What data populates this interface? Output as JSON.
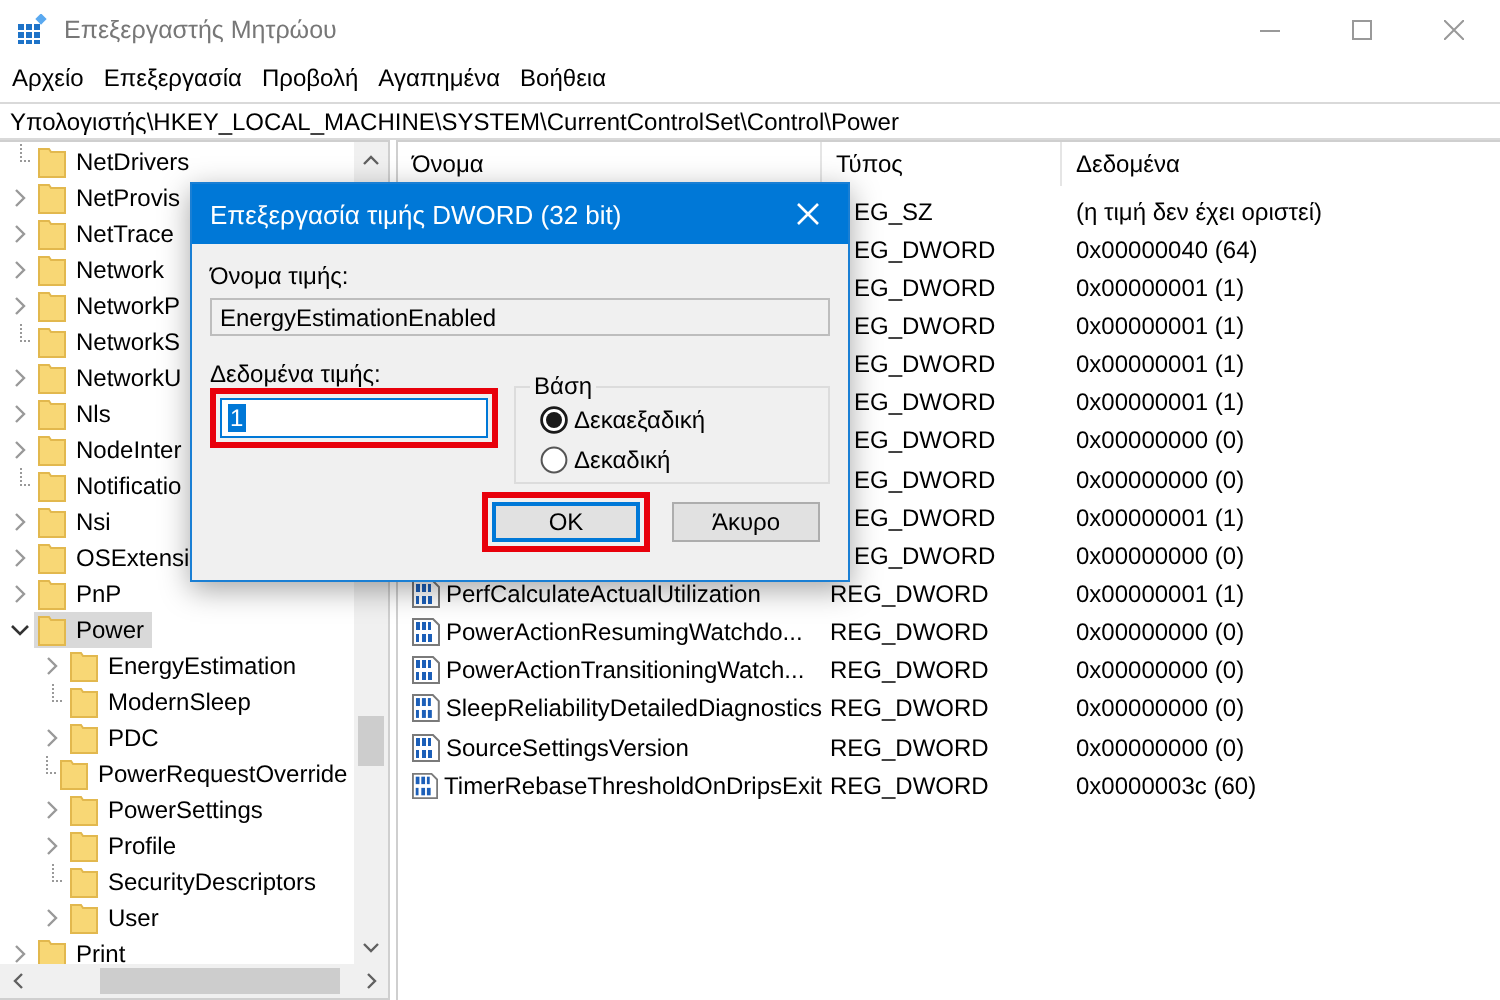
{
  "window": {
    "title": "Επεξεργαστής Μητρώου"
  },
  "menu": [
    "Αρχείο",
    "Επεξεργασία",
    "Προβολή",
    "Αγαπημένα",
    "Βοήθεια"
  ],
  "address": "Υπολογιστής\\HKEY_LOCAL_MACHINE\\SYSTEM\\CurrentControlSet\\Control\\Power",
  "tree": [
    {
      "label": "NetDrivers",
      "kind": "leaf",
      "selected": false
    },
    {
      "label": "NetProvis",
      "kind": "branch",
      "expanded": false,
      "selected": false
    },
    {
      "label": "NetTrace",
      "kind": "branch",
      "expanded": false,
      "selected": false
    },
    {
      "label": "Network",
      "kind": "branch",
      "expanded": false,
      "selected": false
    },
    {
      "label": "NetworkP",
      "kind": "branch",
      "expanded": false,
      "selected": false
    },
    {
      "label": "NetworkS",
      "kind": "leaf",
      "selected": false
    },
    {
      "label": "NetworkU",
      "kind": "branch",
      "expanded": false,
      "selected": false
    },
    {
      "label": "Nls",
      "kind": "branch",
      "expanded": false,
      "selected": false
    },
    {
      "label": "NodeInter",
      "kind": "branch",
      "expanded": false,
      "selected": false
    },
    {
      "label": "Notificatio",
      "kind": "leaf",
      "selected": false
    },
    {
      "label": "Nsi",
      "kind": "branch",
      "expanded": false,
      "selected": false
    },
    {
      "label": "OSExtensi",
      "kind": "branch",
      "expanded": false,
      "selected": false
    },
    {
      "label": "PnP",
      "kind": "branch",
      "expanded": false,
      "selected": false
    },
    {
      "label": "Power",
      "kind": "branch",
      "expanded": true,
      "selected": true,
      "children": [
        {
          "label": "EnergyEstimation",
          "kind": "branch",
          "expanded": false,
          "selected": false
        },
        {
          "label": "ModernSleep",
          "kind": "leaf",
          "selected": false
        },
        {
          "label": "PDC",
          "kind": "branch",
          "expanded": false,
          "selected": false
        },
        {
          "label": "PowerRequestOverride",
          "kind": "leaf",
          "selected": false
        },
        {
          "label": "PowerSettings",
          "kind": "branch",
          "expanded": false,
          "selected": false
        },
        {
          "label": "Profile",
          "kind": "branch",
          "expanded": false,
          "selected": false
        },
        {
          "label": "SecurityDescriptors",
          "kind": "leaf",
          "selected": false
        },
        {
          "label": "User",
          "kind": "branch",
          "expanded": false,
          "selected": false
        }
      ]
    },
    {
      "label": "Print",
      "kind": "branch",
      "expanded": false,
      "selected": false
    }
  ],
  "list": {
    "columns": [
      "Όνομα",
      "Τύπος",
      "Δεδομένα"
    ],
    "rows": [
      {
        "type": "EG_SZ",
        "data": "(η τιμή δεν έχει οριστεί)"
      },
      {
        "type": "EG_DWORD",
        "data": "0x00000040 (64)"
      },
      {
        "type": "EG_DWORD",
        "data": "0x00000001 (1)"
      },
      {
        "type": "EG_DWORD",
        "data": "0x00000001 (1)"
      },
      {
        "type": "EG_DWORD",
        "data": "0x00000001 (1)"
      },
      {
        "type": "EG_DWORD",
        "data": "0x00000001 (1)"
      },
      {
        "type": "EG_DWORD",
        "data": "0x00000000 (0)"
      },
      {
        "type": "EG_DWORD",
        "data": "0x00000000 (0)"
      },
      {
        "type": "EG_DWORD",
        "data": "0x00000001 (1)"
      },
      {
        "type": "EG_DWORD",
        "data": "0x00000000 (0)"
      },
      {
        "kind": "dword",
        "name": "PerfCalculateActualUtilization",
        "type": "REG_DWORD",
        "data": "0x00000001 (1)"
      },
      {
        "kind": "dword",
        "name": "PowerActionResumingWatchdo...",
        "type": "REG_DWORD",
        "data": "0x00000000 (0)"
      },
      {
        "kind": "dword",
        "name": "PowerActionTransitioningWatch...",
        "type": "REG_DWORD",
        "data": "0x00000000 (0)"
      },
      {
        "kind": "dword",
        "name": "SleepReliabilityDetailedDiagnostics",
        "type": "REG_DWORD",
        "data": "0x00000000 (0)"
      },
      {
        "kind": "dword",
        "name": "SourceSettingsVersion",
        "type": "REG_DWORD",
        "data": "0x00000000 (0)"
      },
      {
        "kind": "dword",
        "name": "TimerRebaseThresholdOnDripsExit",
        "type": "REG_DWORD",
        "data": "0x0000003c (60)"
      }
    ]
  },
  "dialog": {
    "title": "Επεξεργασία τιμής DWORD (32 bit)",
    "name_field": {
      "label": "Όνομα τιμής:",
      "value": "EnergyEstimationEnabled"
    },
    "data_field": {
      "label": "Δεδομένα τιμής:",
      "value": "1",
      "highlighted": true
    },
    "base": {
      "label": "Βάση",
      "options": [
        {
          "label": "Δεκαεξαδική",
          "selected": true
        },
        {
          "label": "Δεκαδική",
          "selected": false
        }
      ]
    },
    "buttons": [
      {
        "label": "OK",
        "default": true,
        "highlighted": true
      },
      {
        "label": "Άκυρο",
        "default": false,
        "highlighted": false
      }
    ]
  }
}
